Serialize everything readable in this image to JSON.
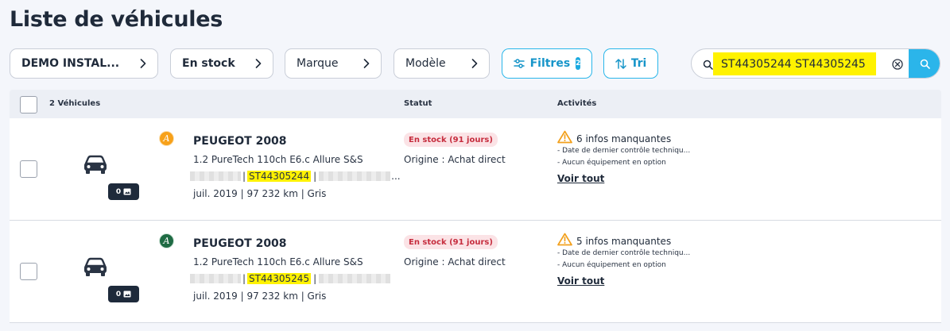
{
  "page": {
    "title": "Liste de véhicules"
  },
  "filters": {
    "site": "DEMO INSTAL...",
    "stock": "En stock",
    "brand": "Marque",
    "model": "Modèle",
    "filters_label": "Filtres",
    "filters_count": "2",
    "sort_label": "Tri"
  },
  "search": {
    "value": "ST44305244 ST44305245",
    "icon": "search-icon",
    "clear_icon": "clear-icon"
  },
  "table": {
    "headers": {
      "count": "2 Véhicules",
      "status": "Statut",
      "activities": "Activités"
    },
    "rows": [
      {
        "photos": "0",
        "grade": "A",
        "grade_color": "#f7a11a",
        "title": "PEUGEOT 2008",
        "version": "1.2 PureTech 110ch E6.c Allure S&S",
        "sep1": "|",
        "stock_number": "ST44305244",
        "sep2": "|",
        "meta": "juil. 2019 | 97 232 km | Gris",
        "status": "En stock (91 jours)",
        "origin": "Origine : Achat direct",
        "missing": "6 infos manquantes",
        "missing_1": "- Date de dernier contrôle techniqu...",
        "missing_2": "- Aucun équipement en option",
        "see_all": "Voir tout"
      },
      {
        "photos": "0",
        "grade": "A",
        "grade_color": "#1f6b44",
        "title": "PEUGEOT 2008",
        "version": "1.2 PureTech 110ch E6.c Allure S&S",
        "sep1": "|",
        "stock_number": "ST44305245",
        "sep2": "|",
        "meta": "juil. 2019 | 97 232 km | Gris",
        "status": "En stock (91 jours)",
        "origin": "Origine : Achat direct",
        "missing": "5 infos manquantes",
        "missing_1": "- Date de dernier contrôle techniqu...",
        "missing_2": "- Aucun équipement en option",
        "see_all": "Voir tout"
      }
    ]
  },
  "colors": {
    "accent": "#29b6ea",
    "highlight": "#fff200",
    "status_bg": "#fbe3e6",
    "status_text": "#c62d3e"
  }
}
